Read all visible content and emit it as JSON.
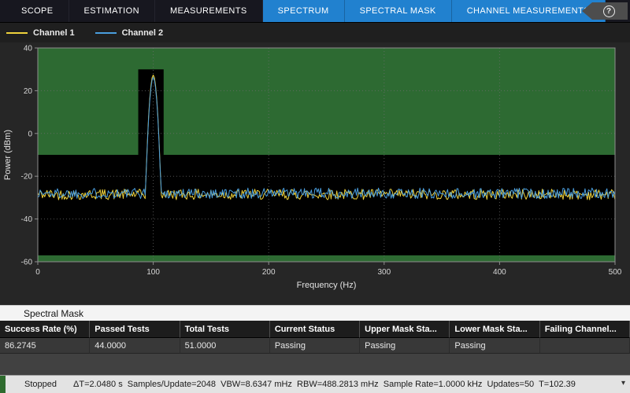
{
  "toolbar": {
    "tabs_dark": [
      "SCOPE",
      "ESTIMATION",
      "MEASUREMENTS"
    ],
    "tabs_blue": [
      "SPECTRUM",
      "SPECTRAL MASK",
      "CHANNEL MEASUREMENTS"
    ]
  },
  "icons": {
    "help": "?",
    "expand": "▾"
  },
  "legend": {
    "items": [
      {
        "label": "Channel 1",
        "color": "#efd23c"
      },
      {
        "label": "Channel 2",
        "color": "#4a9ede"
      }
    ]
  },
  "chart_data": {
    "type": "line",
    "xlabel": "Frequency (Hz)",
    "ylabel": "Power (dBm)",
    "xlim": [
      0,
      500
    ],
    "ylim": [
      -60,
      40
    ],
    "x_ticks": [
      0,
      100,
      200,
      300,
      400,
      500
    ],
    "y_ticks": [
      40,
      20,
      0,
      -20,
      -40,
      -60
    ],
    "grid": true,
    "series": [
      {
        "name": "Channel 1",
        "color": "#efd23c",
        "noise_floor_dbm": -28.5,
        "noise_spread_db": 5,
        "peak_hz": 100,
        "peak_dbm": 27.3,
        "seed": 42
      },
      {
        "name": "Channel 2",
        "color": "#4a9ede",
        "noise_floor_dbm": -28.0,
        "noise_spread_db": 5,
        "peak_hz": 100,
        "peak_dbm": 26.2,
        "seed": 1337
      }
    ],
    "masks": {
      "upper": {
        "color": "#2d6a32",
        "segments": [
          {
            "from_hz": 0,
            "to_hz": 87,
            "level_dbm": -10
          },
          {
            "from_hz": 87,
            "to_hz": 109,
            "level_dbm": 30
          },
          {
            "from_hz": 109,
            "to_hz": 500,
            "level_dbm": -10
          }
        ]
      },
      "lower": {
        "color": "#2d6a32",
        "level_dbm": -57
      }
    }
  },
  "mask_panel": {
    "title": "Spectral Mask",
    "columns": [
      "Success Rate (%)",
      "Passed Tests",
      "Total Tests",
      "Current Status",
      "Upper Mask Sta...",
      "Lower Mask Sta...",
      "Failing Channel..."
    ],
    "row": [
      "86.2745",
      "44.0000",
      "51.0000",
      "Passing",
      "Passing",
      "Passing",
      ""
    ]
  },
  "status_bar": {
    "state": "Stopped",
    "stats": "ΔT=2.0480 s  Samples/Update=2048  VBW=8.6347 mHz  RBW=488.2813 mHz  Sample Rate=1.0000 kHz  Updates=50  T=102.39",
    "indicator_color": "#2e6b2e"
  }
}
